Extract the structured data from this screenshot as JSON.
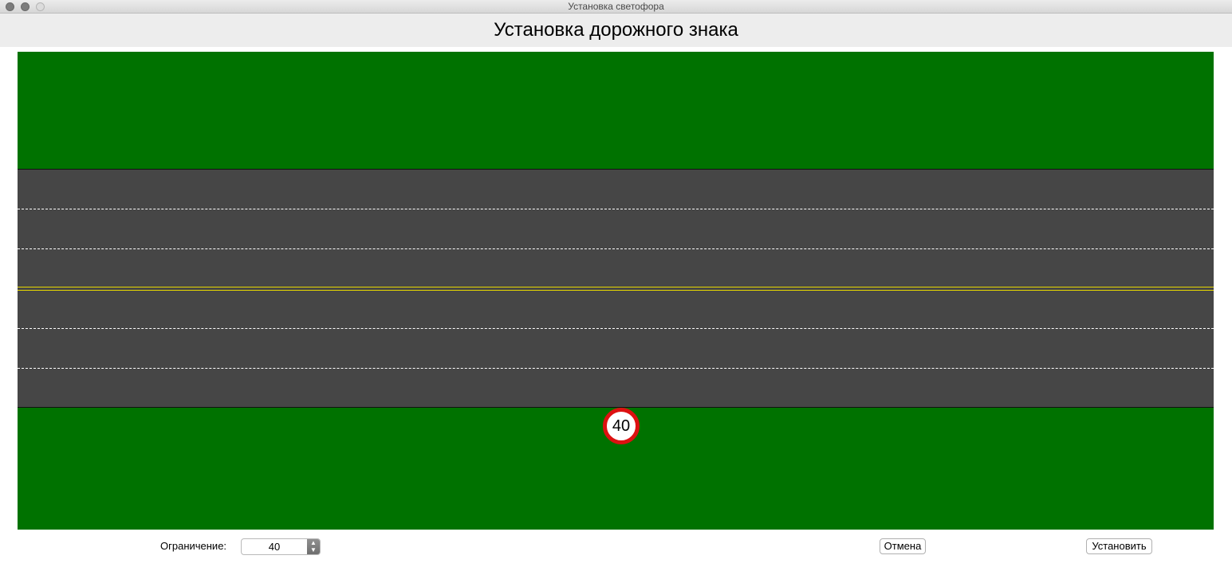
{
  "window": {
    "title": "Установка светофора",
    "controls": [
      "close",
      "minimize",
      "zoom"
    ]
  },
  "header": {
    "title": "Установка дорожного знака"
  },
  "scene": {
    "colors": {
      "grass": "#007200",
      "asphalt": "#464646",
      "lane_marking": "#ffffff",
      "center_marking": "#e8d800",
      "sign_border": "#dd1111"
    },
    "sign": {
      "value": "40",
      "icon": "speed-limit-sign-icon"
    }
  },
  "controls": {
    "limit_label": "Ограничение:",
    "limit_value": "40",
    "stepper_icon": "up-down-stepper-icon",
    "cancel_label": "Отмена",
    "install_label": "Установить"
  }
}
